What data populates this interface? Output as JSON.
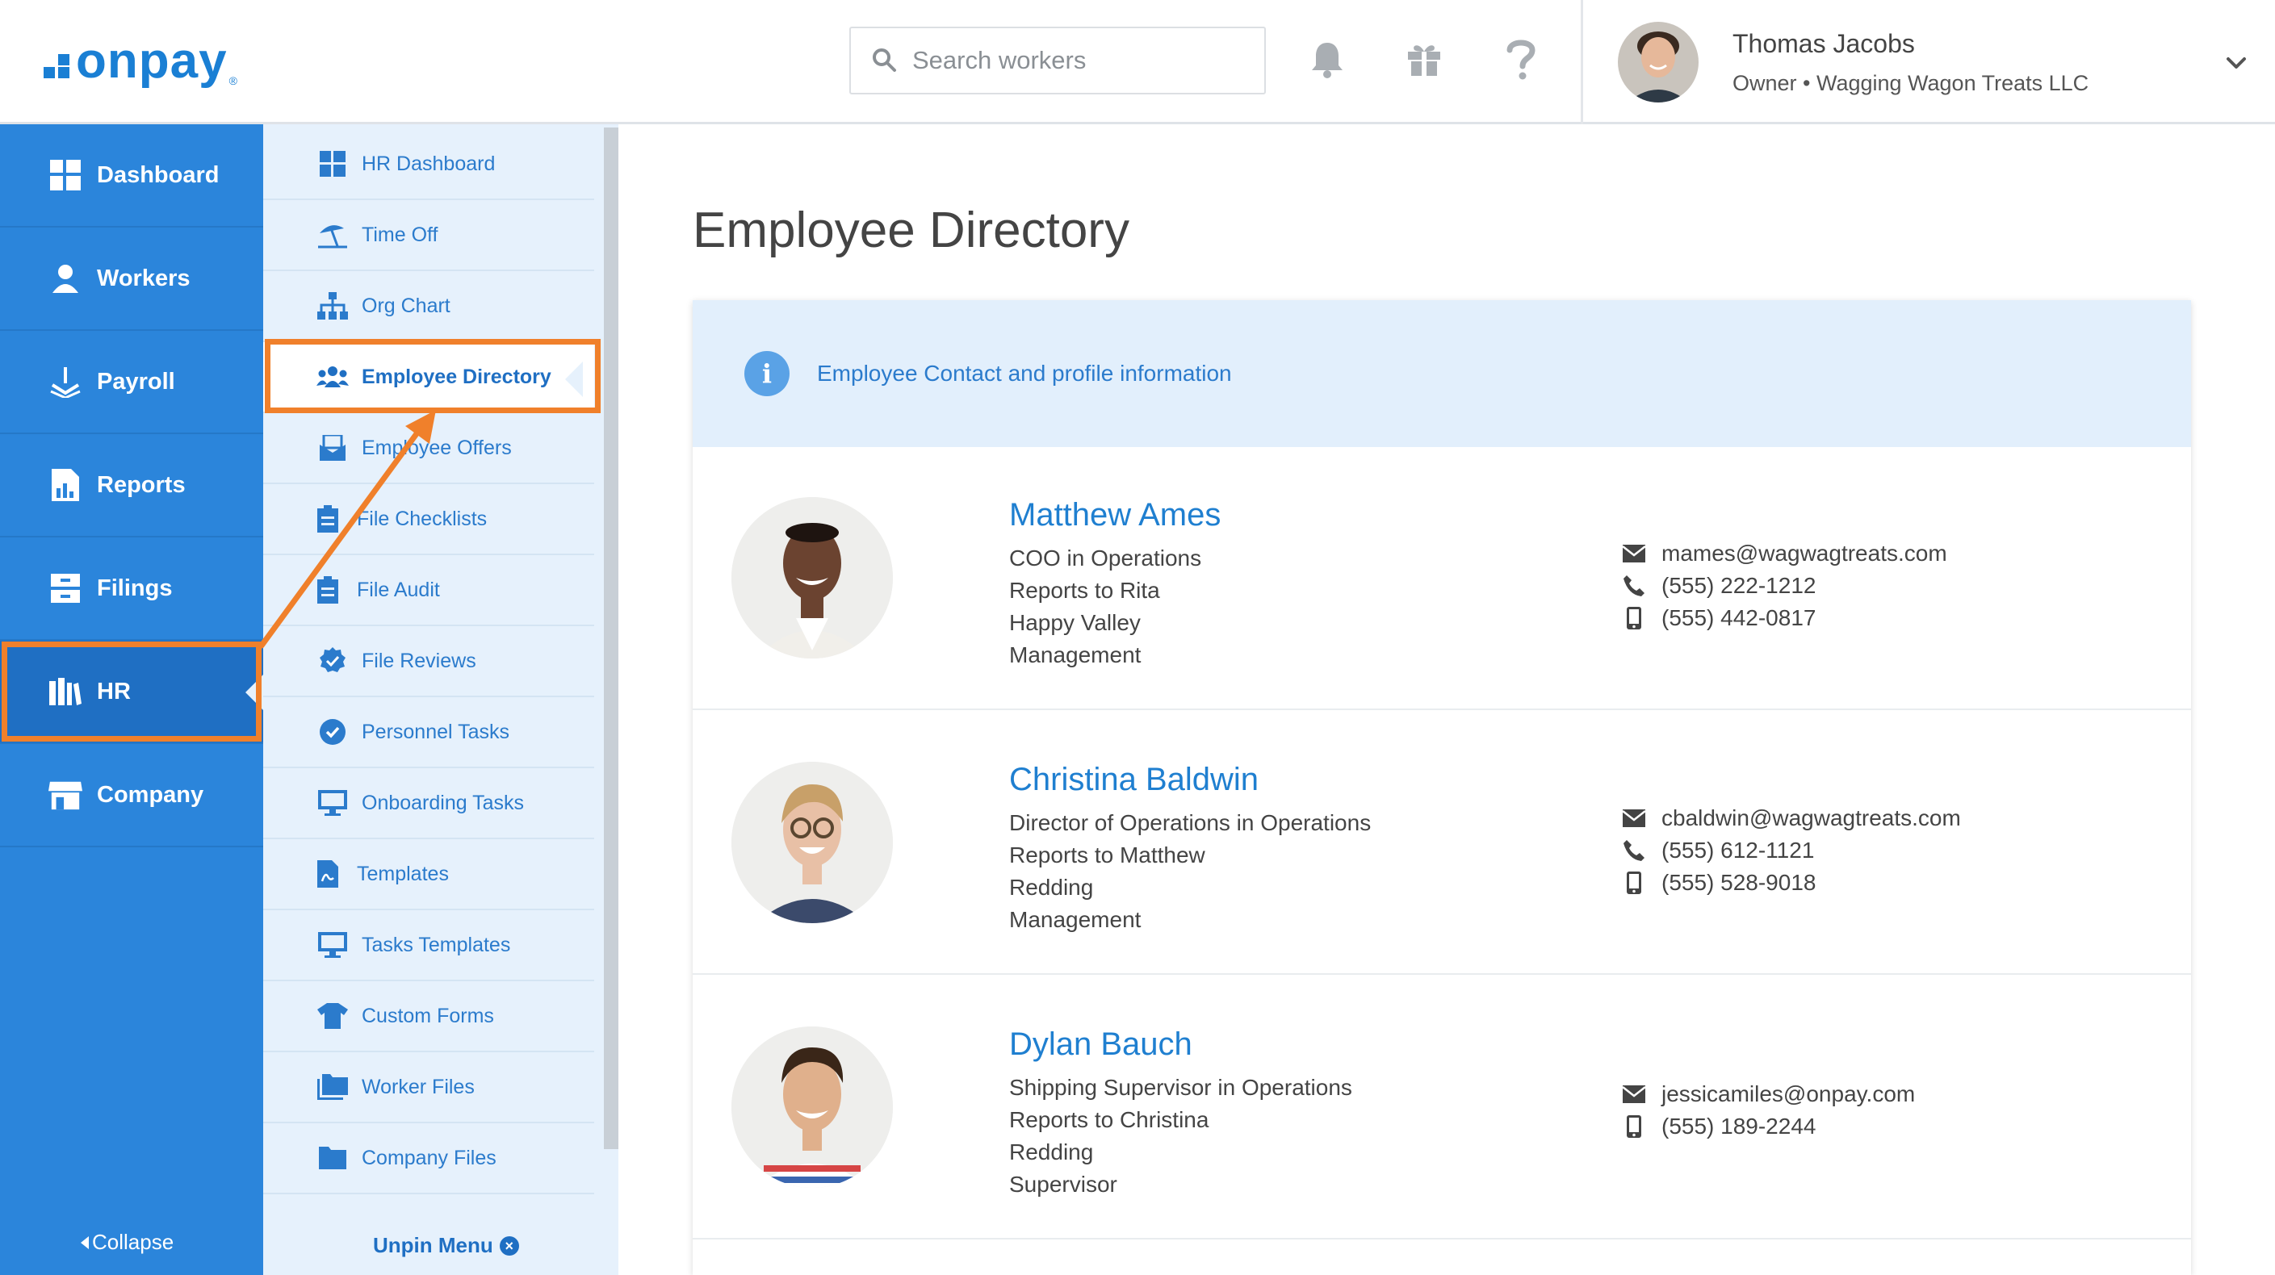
{
  "brand": {
    "name": "onpay",
    "accent": "#1a7fd4",
    "highlight": "#f0802b"
  },
  "search": {
    "placeholder": "Search workers"
  },
  "header_icons": [
    "bell-icon",
    "gift-icon",
    "help-icon"
  ],
  "user": {
    "name": "Thomas Jacobs",
    "subtitle": "Owner • Wagging Wagon Treats LLC"
  },
  "primary_nav": {
    "items": [
      {
        "label": "Dashboard",
        "icon": "grid-icon"
      },
      {
        "label": "Workers",
        "icon": "worker-icon"
      },
      {
        "label": "Payroll",
        "icon": "payroll-icon"
      },
      {
        "label": "Reports",
        "icon": "report-icon"
      },
      {
        "label": "Filings",
        "icon": "filings-icon"
      },
      {
        "label": "HR",
        "icon": "hr-books-icon",
        "active": true
      },
      {
        "label": "Company",
        "icon": "storefront-icon"
      }
    ],
    "collapse_label": "Collapse"
  },
  "hr_nav": {
    "items": [
      {
        "label": "HR Dashboard",
        "icon": "grid-icon"
      },
      {
        "label": "Time Off",
        "icon": "beach-umbrella-icon"
      },
      {
        "label": "Org Chart",
        "icon": "org-chart-icon"
      },
      {
        "label": "Employee Directory",
        "icon": "users-icon",
        "active": true
      },
      {
        "label": "Employee Offers",
        "icon": "offer-envelope-icon"
      },
      {
        "label": "File Checklists",
        "icon": "clipboard-icon"
      },
      {
        "label": "File Audit",
        "icon": "clipboard-icon"
      },
      {
        "label": "File Reviews",
        "icon": "badge-check-icon"
      },
      {
        "label": "Personnel Tasks",
        "icon": "check-circle-icon"
      },
      {
        "label": "Onboarding Tasks",
        "icon": "monitor-icon"
      },
      {
        "label": "Templates",
        "icon": "pdf-file-icon"
      },
      {
        "label": "Tasks Templates",
        "icon": "monitor-icon"
      },
      {
        "label": "Custom Forms",
        "icon": "shirt-icon"
      },
      {
        "label": "Worker Files",
        "icon": "folders-icon"
      },
      {
        "label": "Company Files",
        "icon": "folder-icon"
      }
    ],
    "unpin_label": "Unpin Menu"
  },
  "main": {
    "title": "Employee Directory",
    "banner": "Employee Contact and profile information",
    "employees": [
      {
        "name": "Matthew Ames",
        "title": "COO in Operations",
        "reports_to": "Reports to Rita",
        "location": "Happy Valley",
        "group": "Management",
        "email": "mames@wagwagtreats.com",
        "phone": "(555) 222-1212",
        "mobile": "(555) 442-0817"
      },
      {
        "name": "Christina Baldwin",
        "title": "Director of Operations in Operations",
        "reports_to": "Reports to Matthew",
        "location": "Redding",
        "group": "Management",
        "email": "cbaldwin@wagwagtreats.com",
        "phone": "(555) 612-1121",
        "mobile": "(555) 528-9018"
      },
      {
        "name": "Dylan Bauch",
        "title": "Shipping Supervisor in Operations",
        "reports_to": "Reports to Christina",
        "location": "Redding",
        "group": "Supervisor",
        "email": "jessicamiles@onpay.com",
        "mobile": "(555) 189-2244"
      }
    ]
  }
}
